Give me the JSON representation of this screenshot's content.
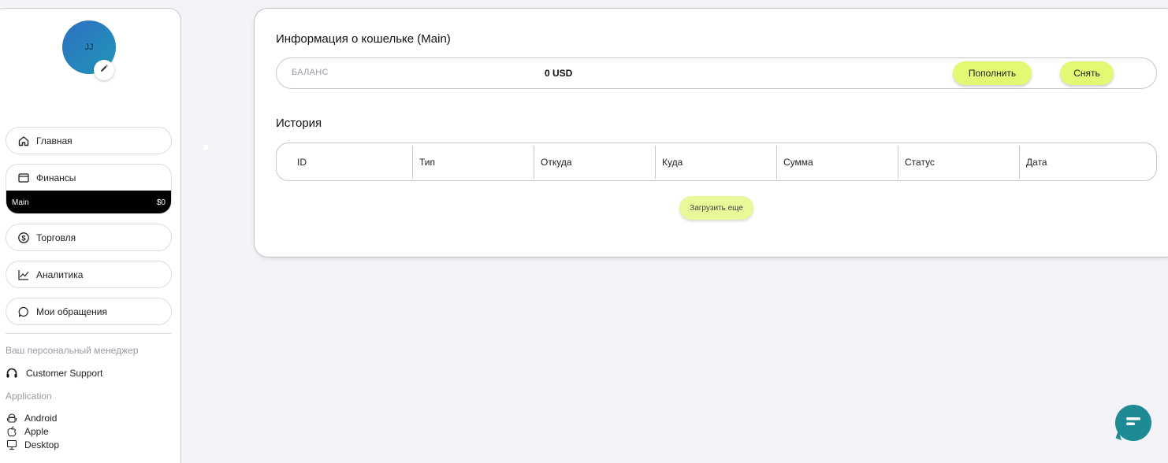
{
  "sidebar": {
    "avatar_initials": "JJ",
    "nav": {
      "home": "Главная",
      "finance": "Финансы",
      "finance_sub": {
        "name": "Main",
        "value": "$0"
      },
      "trading": "Торговля",
      "analytics": "Аналитика",
      "tickets": "Мои обращения"
    },
    "manager_label": "Ваш персональный менеджер",
    "support": "Customer Support",
    "app_label": "Application",
    "apps": {
      "android": "Android",
      "apple": "Apple",
      "desktop": "Desktop"
    }
  },
  "main": {
    "wallet_title": "Информация о кошельке (Main)",
    "balance_label": "БАЛАНС",
    "balance_value": "0 USD",
    "deposit_button": "Пополнить",
    "withdraw_button": "Снять",
    "history_title": "История",
    "history_columns": [
      "ID",
      "Тип",
      "Откуда",
      "Куда",
      "Сумма",
      "Статус",
      "Дата"
    ],
    "load_more": "Загрузить еще"
  },
  "colors": {
    "accent_lime": "#e4f874",
    "avatar_gradient_start": "#2f6fc3",
    "avatar_gradient_end": "#1f97b5",
    "chat_button": "#1e8a93"
  }
}
